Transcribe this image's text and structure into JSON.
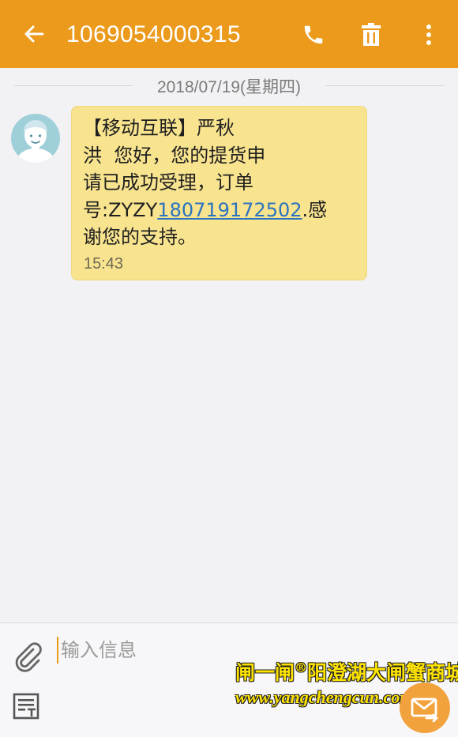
{
  "header": {
    "title": "1069054000315",
    "back_icon": "arrow-left-icon",
    "call_icon": "phone-icon",
    "delete_icon": "trash-icon",
    "more_icon": "more-vertical-icon",
    "bar_color": "#eb9a1c"
  },
  "conversation": {
    "date_divider": "2018/07/19(星期四)",
    "messages": [
      {
        "sender": "incoming",
        "lines": [
          "【移动互联】严秋",
          "洪  您好，您的提货申",
          "请已成功受理，订单"
        ],
        "line4_prefix": "号:ZYZY",
        "order_link": "180719172502",
        "line4_suffix": ".感",
        "line5": "谢您的支持。",
        "time": "15:43",
        "bubble_color": "#f8e38f"
      }
    ]
  },
  "composer": {
    "placeholder": "输入信息",
    "attach_icon": "paperclip-icon",
    "template_icon": "text-template-icon",
    "send_icon": "send-mail-icon"
  },
  "watermark": {
    "line1_a": "闸一闸",
    "reg": "®",
    "line1_b": "阳澄湖大闸蟹商城",
    "line2": "www.yangchengcun.com"
  }
}
